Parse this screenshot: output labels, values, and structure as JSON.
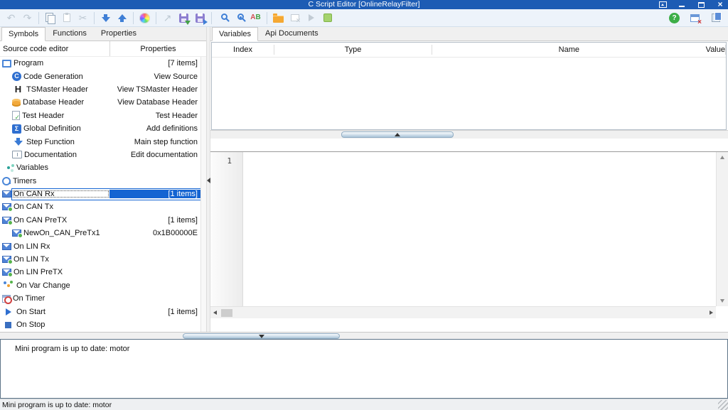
{
  "window": {
    "title": "C Script Editor [OnlineRelayFilter]",
    "controls": [
      "dock",
      "minimize",
      "maximize",
      "close"
    ]
  },
  "toolbar": {
    "buttons": [
      "undo",
      "redo",
      "copy",
      "paste",
      "cut",
      "move-down",
      "move-up",
      "color-wheel",
      "export",
      "save",
      "save-as",
      "find",
      "find-in-view",
      "find-replace",
      "open-folder",
      "clear-editor",
      "run",
      "state-indicator"
    ],
    "right_buttons": [
      "help",
      "close-window",
      "window-layout"
    ]
  },
  "left_panel": {
    "tabs": [
      {
        "label": "Symbols",
        "active": true
      },
      {
        "label": "Functions"
      },
      {
        "label": "Properties"
      }
    ],
    "columns": [
      "Source code editor",
      "Properties"
    ],
    "tree": [
      {
        "icon": "program",
        "label": "Program",
        "value": "[7 items]",
        "level": 0
      },
      {
        "icon": "code-generation",
        "label": "Code Generation",
        "value": "View Source",
        "level": 1
      },
      {
        "icon": "tsmaster-header",
        "label": "TSMaster Header",
        "value": "View TSMaster Header",
        "level": 1
      },
      {
        "icon": "database-header",
        "label": "Database Header",
        "value": "View Database Header",
        "level": 1
      },
      {
        "icon": "test-header",
        "label": "Test Header",
        "value": "Test Header",
        "level": 1
      },
      {
        "icon": "global-definition",
        "label": "Global Definition",
        "value": "Add definitions",
        "level": 1
      },
      {
        "icon": "step-function",
        "label": "Step Function",
        "value": "Main step function",
        "level": 1
      },
      {
        "icon": "documentation",
        "label": "Documentation",
        "value": "Edit documentation",
        "level": 1
      },
      {
        "icon": "variables",
        "label": "Variables",
        "value": "",
        "level": 0
      },
      {
        "icon": "timers",
        "label": "Timers",
        "value": "",
        "level": 0
      },
      {
        "icon": "on-can-rx",
        "label": "On CAN Rx",
        "value": "[1 items]",
        "level": 0,
        "selected": true
      },
      {
        "icon": "on-can-tx",
        "label": "On CAN Tx",
        "value": "",
        "level": 0
      },
      {
        "icon": "on-can-pretx",
        "label": "On CAN PreTX",
        "value": "[1 items]",
        "level": 0
      },
      {
        "icon": "on-can-pretx",
        "label": "NewOn_CAN_PreTx1",
        "value": "0x1B00000E",
        "level": 1
      },
      {
        "icon": "on-lin-rx",
        "label": "On LIN Rx",
        "value": "",
        "level": 0
      },
      {
        "icon": "on-lin-tx",
        "label": "On LIN Tx",
        "value": "",
        "level": 0
      },
      {
        "icon": "on-lin-pretx",
        "label": "On LIN PreTX",
        "value": "",
        "level": 0
      },
      {
        "icon": "on-var-change",
        "label": "On Var Change",
        "value": "",
        "level": 0
      },
      {
        "icon": "on-timer",
        "label": "On Timer",
        "value": "",
        "level": 0
      },
      {
        "icon": "on-start",
        "label": "On Start",
        "value": "[1 items]",
        "level": 0
      },
      {
        "icon": "on-stop",
        "label": "On Stop",
        "value": "",
        "level": 0
      }
    ]
  },
  "right_panel": {
    "tabs": [
      {
        "label": "Variables",
        "active": true
      },
      {
        "label": "Api Documents"
      }
    ],
    "table": {
      "columns": [
        "Index",
        "Type",
        "Name",
        "Value"
      ],
      "rows": []
    },
    "editor": {
      "line1": "1",
      "content": ""
    }
  },
  "message_panel": {
    "text": "Mini program is up to date: motor"
  },
  "status_bar": {
    "text": "Mini program is up to date: motor"
  }
}
